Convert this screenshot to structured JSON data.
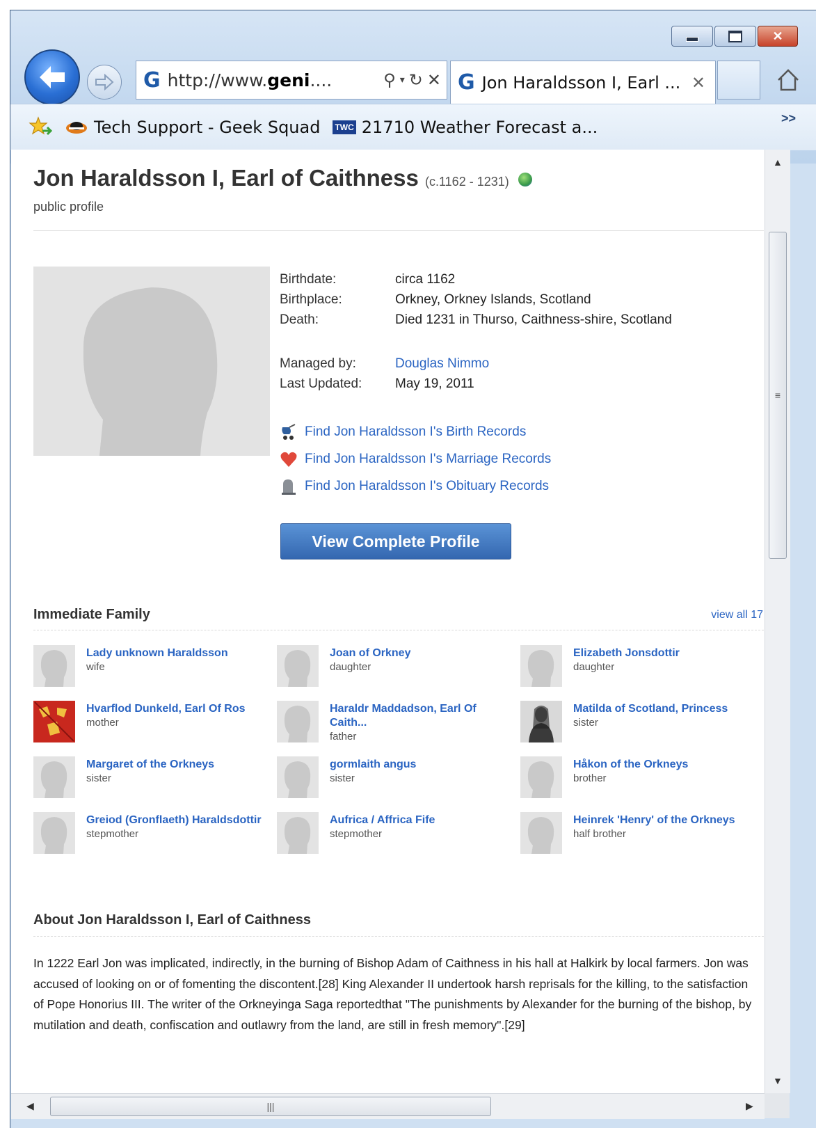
{
  "browser": {
    "url_prefix": "http://www.",
    "url_bold": "geni",
    "url_suffix": "....",
    "tab_title": "Jon Haraldsson I, Earl ...",
    "favorites": [
      {
        "label": "Tech Support - Geek Squad",
        "icon": "geek-squad-icon"
      },
      {
        "label": "21710 Weather Forecast a...",
        "icon": "twc-icon",
        "badge": "TWC"
      }
    ],
    "more_glyph": ">>"
  },
  "profile": {
    "name": "Jon Haraldsson I, Earl of Caithness",
    "dates": "(c.1162 - 1231)",
    "visibility": "public profile",
    "facts": [
      {
        "label": "Birthdate:",
        "value": "circa 1162"
      },
      {
        "label": "Birthplace:",
        "value": "Orkney, Orkney Islands, Scotland"
      },
      {
        "label": "Death:",
        "value": "Died 1231 in Thurso, Caithness-shire, Scotland"
      }
    ],
    "meta": [
      {
        "label": "Managed by:",
        "value": "Douglas Nimmo"
      },
      {
        "label": "Last Updated:",
        "value": "May 19, 2011"
      }
    ],
    "records": [
      {
        "label": "Find Jon Haraldsson I's Birth Records",
        "icon": "stroller-icon"
      },
      {
        "label": "Find Jon Haraldsson I's Marriage Records",
        "icon": "heart-icon"
      },
      {
        "label": "Find Jon Haraldsson I's Obituary Records",
        "icon": "gravestone-icon"
      }
    ],
    "view_button": "View Complete Profile"
  },
  "family": {
    "title": "Immediate Family",
    "view_all": "view all 17",
    "members": [
      {
        "name": "Lady unknown Haraldsson",
        "relation": "wife",
        "photo": "placeholder"
      },
      {
        "name": "Joan of Orkney",
        "relation": "daughter",
        "photo": "placeholder"
      },
      {
        "name": "Elizabeth Jonsdottir",
        "relation": "daughter",
        "photo": "placeholder"
      },
      {
        "name": "Hvarflod Dunkeld, Earl Of Ros",
        "relation": "mother",
        "photo": "coat-of-arms"
      },
      {
        "name": "Haraldr Maddadson, Earl Of Caith...",
        "relation": "father",
        "photo": "placeholder"
      },
      {
        "name": "Matilda of Scotland, Princess",
        "relation": "sister",
        "photo": "portrait"
      },
      {
        "name": "Margaret of the Orkneys",
        "relation": "sister",
        "photo": "placeholder"
      },
      {
        "name": "gormlaith angus",
        "relation": "sister",
        "photo": "placeholder"
      },
      {
        "name": "Håkon of the Orkneys",
        "relation": "brother",
        "photo": "placeholder"
      },
      {
        "name": "Greiod (Gronflaeth) Haraldsdottir",
        "relation": "stepmother",
        "photo": "placeholder"
      },
      {
        "name": "Aufrica / Affrica Fife",
        "relation": "stepmother",
        "photo": "placeholder"
      },
      {
        "name": "Heinrek 'Henry' of the Orkneys",
        "relation": "half brother",
        "photo": "placeholder"
      }
    ]
  },
  "about": {
    "title": "About Jon Haraldsson I, Earl of Caithness",
    "text": "In 1222 Earl Jon was implicated, indirectly, in the burning of Bishop Adam of Caithness in his hall at Halkirk by local farmers. Jon was accused of looking on or of fomenting the discontent.[28] King Alexander II undertook harsh reprisals for the killing, to the satisfaction of Pope Honorius III. The writer of the Orkneyinga Saga reportedthat \"The punishments by Alexander for the burning of the bishop, by mutilation and death, confiscation and outlawry from the land, are still in fresh memory\".[29]"
  },
  "colors": {
    "link": "#2a64c2",
    "button": "#3a6fb8",
    "chrome": "#c3d8ef"
  }
}
